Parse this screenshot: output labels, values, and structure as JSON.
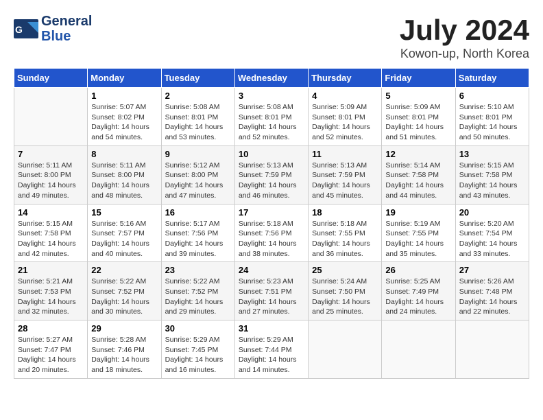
{
  "header": {
    "logo_general": "General",
    "logo_blue": "Blue",
    "month": "July 2024",
    "location": "Kowon-up, North Korea"
  },
  "weekdays": [
    "Sunday",
    "Monday",
    "Tuesday",
    "Wednesday",
    "Thursday",
    "Friday",
    "Saturday"
  ],
  "weeks": [
    [
      {
        "day": "",
        "info": ""
      },
      {
        "day": "1",
        "info": "Sunrise: 5:07 AM\nSunset: 8:02 PM\nDaylight: 14 hours\nand 54 minutes."
      },
      {
        "day": "2",
        "info": "Sunrise: 5:08 AM\nSunset: 8:01 PM\nDaylight: 14 hours\nand 53 minutes."
      },
      {
        "day": "3",
        "info": "Sunrise: 5:08 AM\nSunset: 8:01 PM\nDaylight: 14 hours\nand 52 minutes."
      },
      {
        "day": "4",
        "info": "Sunrise: 5:09 AM\nSunset: 8:01 PM\nDaylight: 14 hours\nand 52 minutes."
      },
      {
        "day": "5",
        "info": "Sunrise: 5:09 AM\nSunset: 8:01 PM\nDaylight: 14 hours\nand 51 minutes."
      },
      {
        "day": "6",
        "info": "Sunrise: 5:10 AM\nSunset: 8:01 PM\nDaylight: 14 hours\nand 50 minutes."
      }
    ],
    [
      {
        "day": "7",
        "info": "Sunrise: 5:11 AM\nSunset: 8:00 PM\nDaylight: 14 hours\nand 49 minutes."
      },
      {
        "day": "8",
        "info": "Sunrise: 5:11 AM\nSunset: 8:00 PM\nDaylight: 14 hours\nand 48 minutes."
      },
      {
        "day": "9",
        "info": "Sunrise: 5:12 AM\nSunset: 8:00 PM\nDaylight: 14 hours\nand 47 minutes."
      },
      {
        "day": "10",
        "info": "Sunrise: 5:13 AM\nSunset: 7:59 PM\nDaylight: 14 hours\nand 46 minutes."
      },
      {
        "day": "11",
        "info": "Sunrise: 5:13 AM\nSunset: 7:59 PM\nDaylight: 14 hours\nand 45 minutes."
      },
      {
        "day": "12",
        "info": "Sunrise: 5:14 AM\nSunset: 7:58 PM\nDaylight: 14 hours\nand 44 minutes."
      },
      {
        "day": "13",
        "info": "Sunrise: 5:15 AM\nSunset: 7:58 PM\nDaylight: 14 hours\nand 43 minutes."
      }
    ],
    [
      {
        "day": "14",
        "info": "Sunrise: 5:15 AM\nSunset: 7:58 PM\nDaylight: 14 hours\nand 42 minutes."
      },
      {
        "day": "15",
        "info": "Sunrise: 5:16 AM\nSunset: 7:57 PM\nDaylight: 14 hours\nand 40 minutes."
      },
      {
        "day": "16",
        "info": "Sunrise: 5:17 AM\nSunset: 7:56 PM\nDaylight: 14 hours\nand 39 minutes."
      },
      {
        "day": "17",
        "info": "Sunrise: 5:18 AM\nSunset: 7:56 PM\nDaylight: 14 hours\nand 38 minutes."
      },
      {
        "day": "18",
        "info": "Sunrise: 5:18 AM\nSunset: 7:55 PM\nDaylight: 14 hours\nand 36 minutes."
      },
      {
        "day": "19",
        "info": "Sunrise: 5:19 AM\nSunset: 7:55 PM\nDaylight: 14 hours\nand 35 minutes."
      },
      {
        "day": "20",
        "info": "Sunrise: 5:20 AM\nSunset: 7:54 PM\nDaylight: 14 hours\nand 33 minutes."
      }
    ],
    [
      {
        "day": "21",
        "info": "Sunrise: 5:21 AM\nSunset: 7:53 PM\nDaylight: 14 hours\nand 32 minutes."
      },
      {
        "day": "22",
        "info": "Sunrise: 5:22 AM\nSunset: 7:52 PM\nDaylight: 14 hours\nand 30 minutes."
      },
      {
        "day": "23",
        "info": "Sunrise: 5:22 AM\nSunset: 7:52 PM\nDaylight: 14 hours\nand 29 minutes."
      },
      {
        "day": "24",
        "info": "Sunrise: 5:23 AM\nSunset: 7:51 PM\nDaylight: 14 hours\nand 27 minutes."
      },
      {
        "day": "25",
        "info": "Sunrise: 5:24 AM\nSunset: 7:50 PM\nDaylight: 14 hours\nand 25 minutes."
      },
      {
        "day": "26",
        "info": "Sunrise: 5:25 AM\nSunset: 7:49 PM\nDaylight: 14 hours\nand 24 minutes."
      },
      {
        "day": "27",
        "info": "Sunrise: 5:26 AM\nSunset: 7:48 PM\nDaylight: 14 hours\nand 22 minutes."
      }
    ],
    [
      {
        "day": "28",
        "info": "Sunrise: 5:27 AM\nSunset: 7:47 PM\nDaylight: 14 hours\nand 20 minutes."
      },
      {
        "day": "29",
        "info": "Sunrise: 5:28 AM\nSunset: 7:46 PM\nDaylight: 14 hours\nand 18 minutes."
      },
      {
        "day": "30",
        "info": "Sunrise: 5:29 AM\nSunset: 7:45 PM\nDaylight: 14 hours\nand 16 minutes."
      },
      {
        "day": "31",
        "info": "Sunrise: 5:29 AM\nSunset: 7:44 PM\nDaylight: 14 hours\nand 14 minutes."
      },
      {
        "day": "",
        "info": ""
      },
      {
        "day": "",
        "info": ""
      },
      {
        "day": "",
        "info": ""
      }
    ]
  ]
}
